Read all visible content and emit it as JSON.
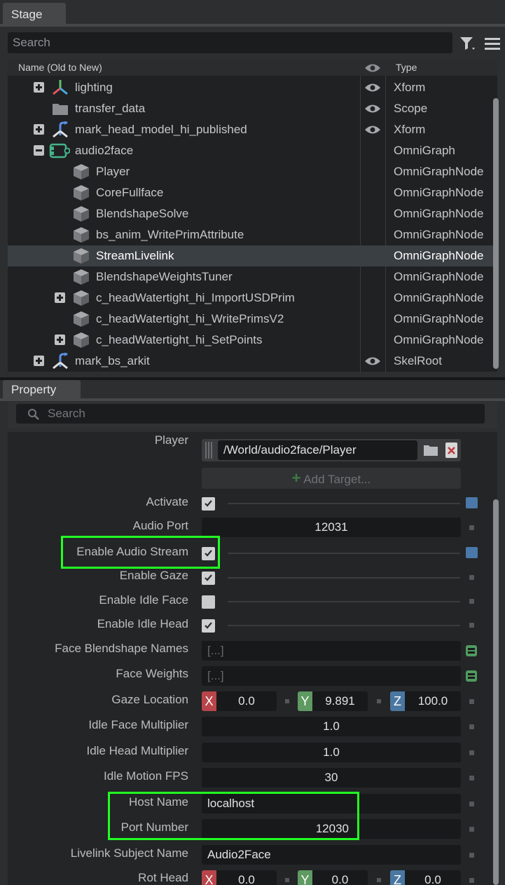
{
  "stage": {
    "tab_label": "Stage",
    "search_placeholder": "Search",
    "columns": {
      "name": "Name (Old to New)",
      "type": "Type"
    },
    "rows": [
      {
        "name": "lighting",
        "type": "Xform",
        "expander": "plus",
        "icon": "xform-axes-icon",
        "visible_eye": true
      },
      {
        "name": "transfer_data",
        "type": "Scope",
        "expander": "",
        "icon": "folder-icon",
        "visible_eye": true
      },
      {
        "name": "mark_head_model_hi_published",
        "type": "Xform",
        "expander": "plus",
        "icon": "xform-axes-blue-icon",
        "visible_eye": true
      },
      {
        "name": "audio2face",
        "type": "OmniGraph",
        "expander": "minus",
        "icon": "omnigraph-icon",
        "visible_eye": false
      },
      {
        "name": "Player",
        "type": "OmniGraphNode",
        "icon": "cube-icon"
      },
      {
        "name": "CoreFullface",
        "type": "OmniGraphNode",
        "icon": "cube-icon"
      },
      {
        "name": "BlendshapeSolve",
        "type": "OmniGraphNode",
        "icon": "cube-icon"
      },
      {
        "name": "bs_anim_WritePrimAttribute",
        "type": "OmniGraphNode",
        "icon": "cube-icon"
      },
      {
        "name": "StreamLivelink",
        "type": "OmniGraphNode",
        "icon": "cube-icon",
        "selected": true
      },
      {
        "name": "BlendshapeWeightsTuner",
        "type": "OmniGraphNode",
        "icon": "cube-icon"
      },
      {
        "name": "c_headWatertight_hi_ImportUSDPrim",
        "type": "OmniGraphNode",
        "icon": "cube-icon",
        "expander": "plus"
      },
      {
        "name": "c_headWatertight_hi_WritePrimsV2",
        "type": "OmniGraphNode",
        "icon": "cube-icon"
      },
      {
        "name": "c_headWatertight_hi_SetPoints",
        "type": "OmniGraphNode",
        "icon": "cube-icon",
        "expander": "plus"
      },
      {
        "name": "mark_bs_arkit",
        "type": "SkelRoot",
        "expander": "plus",
        "icon": "skelroot-icon",
        "visible_eye": true
      }
    ]
  },
  "property": {
    "tab_label": "Property",
    "search_placeholder": "Search",
    "player": {
      "label": "Player",
      "path": "/World/audio2face/Player",
      "add_target": "Add Target..."
    },
    "activate": {
      "label": "Activate",
      "checked": true
    },
    "audio_port": {
      "label": "Audio Port",
      "value": "12031"
    },
    "enable_audio_stream": {
      "label": "Enable Audio Stream",
      "checked": true
    },
    "enable_gaze": {
      "label": "Enable Gaze",
      "checked": true
    },
    "enable_idle_face": {
      "label": "Enable Idle Face",
      "checked": false
    },
    "enable_idle_head": {
      "label": "Enable Idle Head",
      "checked": true
    },
    "face_blendshape_names": {
      "label": "Face Blendshape Names",
      "value": "[...]"
    },
    "face_weights": {
      "label": "Face Weights",
      "value": "[...]"
    },
    "gaze_location": {
      "label": "Gaze Location",
      "x": "0.0",
      "y": "9.891",
      "z": "100.0"
    },
    "idle_face_multiplier": {
      "label": "Idle Face Multiplier",
      "value": "1.0"
    },
    "idle_head_multiplier": {
      "label": "Idle Head Multiplier",
      "value": "1.0"
    },
    "idle_motion_fps": {
      "label": "Idle Motion FPS",
      "value": "30"
    },
    "host_name": {
      "label": "Host Name",
      "value": "localhost"
    },
    "port_number": {
      "label": "Port Number",
      "value": "12030"
    },
    "livelink_subject_name": {
      "label": "Livelink Subject Name",
      "value": "Audio2Face"
    },
    "rot_head": {
      "label": "Rot Head",
      "x": "0.0",
      "y": "0.0",
      "z": "0.0"
    },
    "axis_labels": {
      "x": "X",
      "y": "Y",
      "z": "Z"
    }
  },
  "colors": {
    "highlight": "#22ff22",
    "x_axis": "#b8454a",
    "y_axis": "#5e9a62",
    "z_axis": "#4a77a1",
    "accent_blue": "#4a78a8"
  }
}
